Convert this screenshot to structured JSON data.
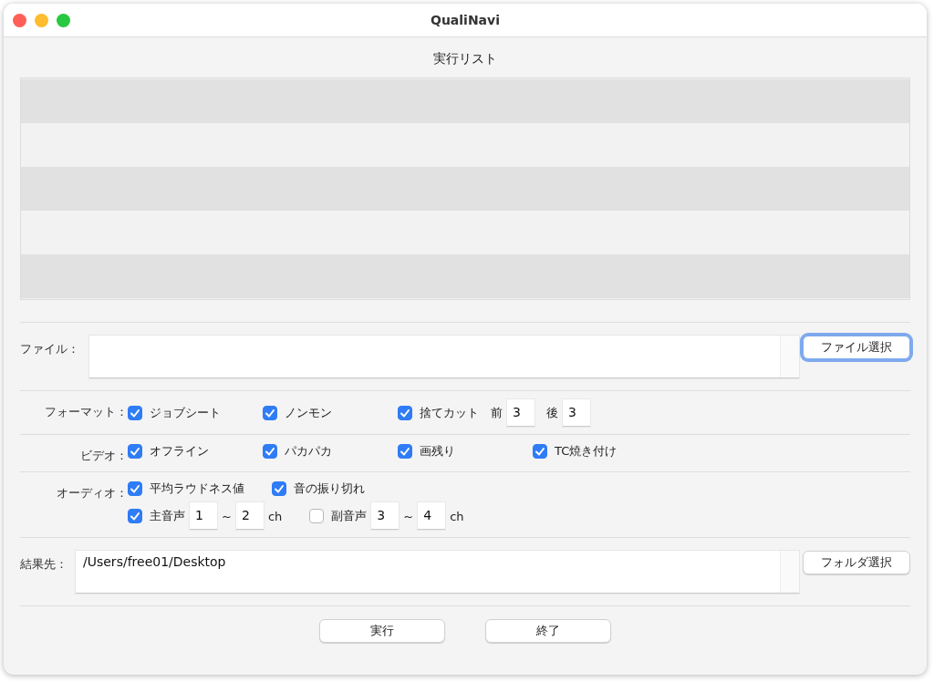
{
  "window": {
    "title": "QualiNavi"
  },
  "run_list": {
    "title": "実行リスト"
  },
  "file": {
    "label": "ファイル：",
    "button": {
      "label": "ファイル選択",
      "focused": true
    }
  },
  "options": [
    {
      "label": "フォーマット：",
      "lines": [
        [
          [
            {
              "kind": "check",
              "label": "ジョブシート",
              "checked": true
            }
          ],
          [
            {
              "kind": "check",
              "label": "ノンモン",
              "checked": true
            }
          ],
          [
            {
              "kind": "check",
              "label": "捨てカット",
              "checked": true
            },
            {
              "kind": "number",
              "label": "前",
              "value": "3"
            },
            {
              "kind": "number",
              "label": "後",
              "value": "3"
            }
          ]
        ]
      ]
    },
    {
      "label": "ビデオ：",
      "lines": [
        [
          [
            {
              "kind": "check",
              "label": "オフライン",
              "checked": true
            }
          ],
          [
            {
              "kind": "check",
              "label": "パカパカ",
              "checked": true
            }
          ],
          [
            {
              "kind": "check",
              "label": "画残り",
              "checked": true
            }
          ],
          [
            {
              "kind": "check",
              "label": "TC焼き付け",
              "checked": true
            }
          ]
        ]
      ]
    },
    {
      "label": "オーディオ：",
      "lines": [
        [
          [
            {
              "kind": "check",
              "label": "平均ラウドネス値",
              "checked": true
            }
          ],
          [
            {
              "kind": "check",
              "label": "音の振り切れ",
              "checked": true
            }
          ]
        ],
        [
          [
            {
              "kind": "check",
              "label": "主音声",
              "checked": true
            },
            {
              "kind": "number",
              "value": "1"
            },
            {
              "kind": "text",
              "label": "~"
            },
            {
              "kind": "number",
              "value": "2"
            },
            {
              "kind": "text",
              "label": "ch"
            }
          ],
          [
            {
              "kind": "check",
              "label": "副音声",
              "checked": false
            },
            {
              "kind": "number",
              "value": "3"
            },
            {
              "kind": "text",
              "label": "~"
            },
            {
              "kind": "number",
              "value": "4"
            },
            {
              "kind": "text",
              "label": "ch"
            }
          ]
        ]
      ]
    }
  ],
  "result": {
    "label": "結果先：",
    "value": "/Users/free01/Desktop",
    "button": {
      "label": "フォルダ選択",
      "focused": false
    }
  },
  "buttons": [
    "実行",
    "終了"
  ]
}
